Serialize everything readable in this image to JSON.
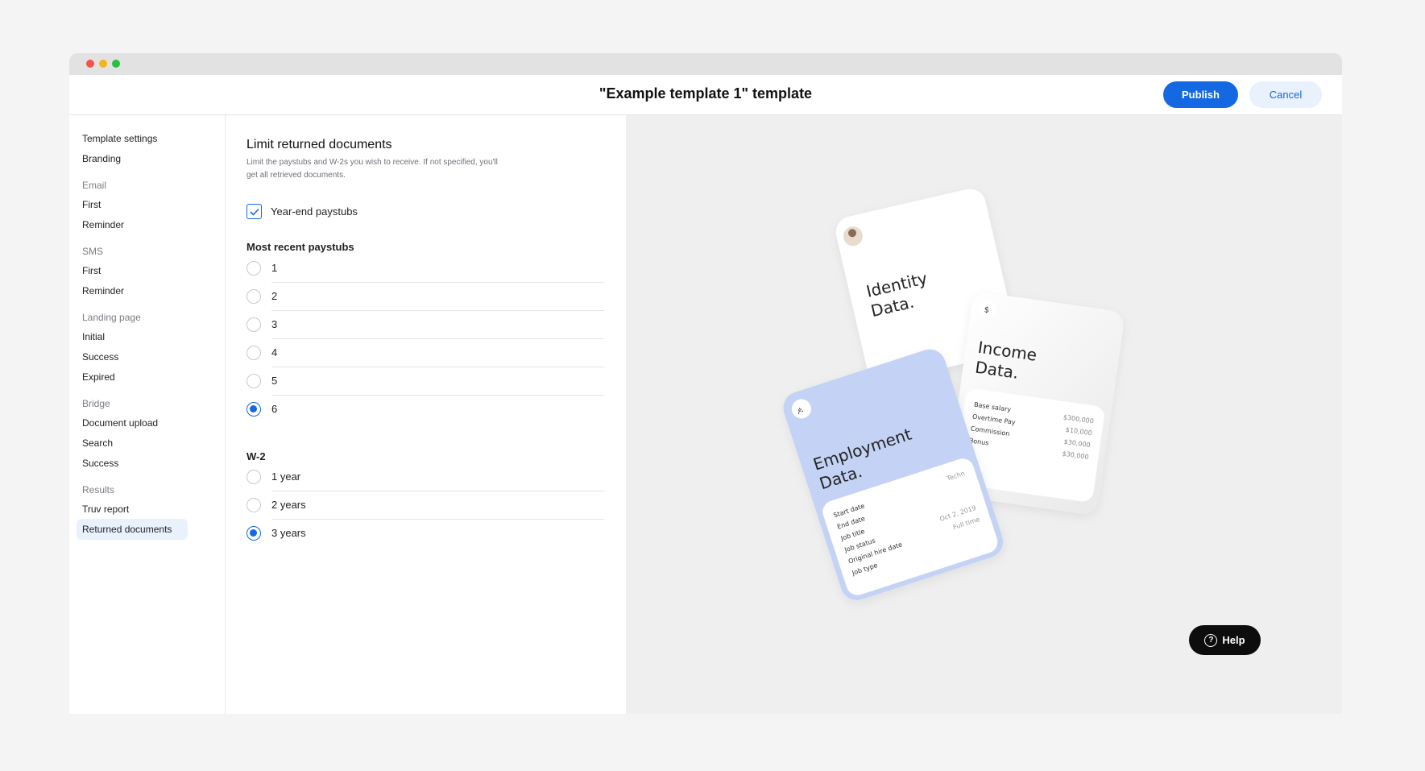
{
  "window": {
    "title": "\"Example template 1\" template"
  },
  "header": {
    "publish_label": "Publish",
    "cancel_label": "Cancel"
  },
  "sidebar": {
    "items": [
      {
        "label": "Template settings"
      },
      {
        "label": "Branding"
      }
    ],
    "groups": [
      {
        "heading": "Email",
        "items": [
          "First",
          "Reminder"
        ]
      },
      {
        "heading": "SMS",
        "items": [
          "First",
          "Reminder"
        ]
      },
      {
        "heading": "Landing page",
        "items": [
          "Initial",
          "Success",
          "Expired"
        ]
      },
      {
        "heading": "Bridge",
        "items": [
          "Document upload",
          "Search",
          "Success"
        ]
      },
      {
        "heading": "Results",
        "items": [
          "Truv report",
          "Returned documents"
        ]
      }
    ],
    "active": "Returned documents"
  },
  "content": {
    "title": "Limit returned documents",
    "description": "Limit the paystubs and W-2s you wish to receive. If not specified, you'll get all retrieved documents.",
    "year_end_label": "Year-end paystubs",
    "year_end_checked": true,
    "paystubs": {
      "heading": "Most recent paystubs",
      "options": [
        "1",
        "2",
        "3",
        "4",
        "5",
        "6"
      ],
      "selected": "6"
    },
    "w2": {
      "heading": "W-2",
      "options": [
        "1 year",
        "2 years",
        "3 years"
      ],
      "selected": "3 years"
    }
  },
  "preview": {
    "identity_card": {
      "title_line1": "Identity",
      "title_line2": "Data."
    },
    "income_card": {
      "icon": "$",
      "title_line1": "Income",
      "title_line2": "Data.",
      "rows": [
        {
          "label": "Base salary",
          "value": "$300,000"
        },
        {
          "label": "Overtime Pay",
          "value": "$10,000"
        },
        {
          "label": "Commission",
          "value": "$30,000"
        },
        {
          "label": "Bonus",
          "value": "$30,000"
        }
      ]
    },
    "employment_card": {
      "title_line1": "Employment",
      "title_line2": "Data.",
      "rows": [
        "Start date",
        "End date",
        "Job title",
        "Job status",
        "Original hire date",
        "Job type"
      ],
      "values": [
        "Techn",
        "Oct 2, 2019",
        "Full time"
      ]
    }
  },
  "help": {
    "label": "Help"
  },
  "colors": {
    "accent": "#1469e3",
    "accent_light": "#e8f1fc",
    "employment_card": "#c4d3f5"
  }
}
